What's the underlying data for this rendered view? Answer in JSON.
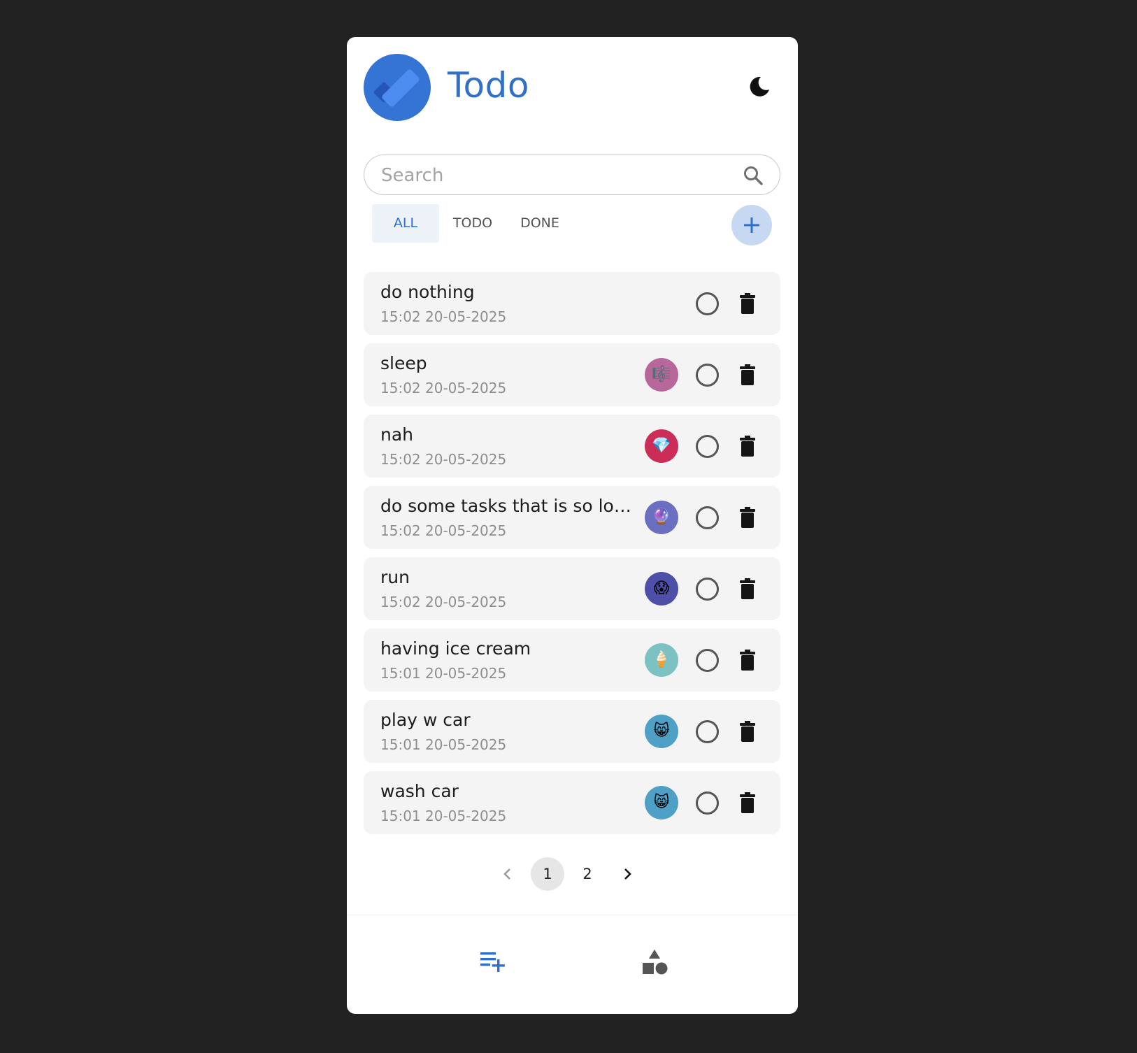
{
  "app": {
    "title": "Todo",
    "theme_toggle_icon": "moon-icon"
  },
  "search": {
    "placeholder": "Search",
    "value": "",
    "icon": "search-icon"
  },
  "filters": {
    "tabs": [
      {
        "label": "ALL",
        "active": true
      },
      {
        "label": "TODO",
        "active": false
      },
      {
        "label": "DONE",
        "active": false
      }
    ],
    "add_icon": "plus-icon"
  },
  "todos": [
    {
      "title": "do nothing",
      "time": "15:02 20-05-2025",
      "emoji": "",
      "emoji_bg": "",
      "done": false
    },
    {
      "title": "sleep",
      "time": "15:02 20-05-2025",
      "emoji": "🎼",
      "emoji_bg": "#b8679a",
      "done": false
    },
    {
      "title": "nah",
      "time": "15:02 20-05-2025",
      "emoji": "💎",
      "emoji_bg": "#cc2c58",
      "done": false
    },
    {
      "title": "do some tasks that is so long...",
      "time": "15:02 20-05-2025",
      "emoji": "🔮",
      "emoji_bg": "#6b6fbf",
      "done": false
    },
    {
      "title": "run",
      "time": "15:02 20-05-2025",
      "emoji": "😱",
      "emoji_bg": "#4e4fa8",
      "done": false
    },
    {
      "title": "having ice cream",
      "time": "15:01 20-05-2025",
      "emoji": "🍦",
      "emoji_bg": "#7cc2c2",
      "done": false
    },
    {
      "title": "play w car",
      "time": "15:01 20-05-2025",
      "emoji": "😸",
      "emoji_bg": "#4fa0c6",
      "done": false
    },
    {
      "title": "wash car",
      "time": "15:01 20-05-2025",
      "emoji": "😸",
      "emoji_bg": "#4fa0c6",
      "done": false
    }
  ],
  "pagination": {
    "prev_icon": "chevron-left-icon",
    "pages": [
      "1",
      "2"
    ],
    "current": "1",
    "next_icon": "chevron-right-icon"
  },
  "bottom_nav": [
    {
      "icon": "playlist-add-icon",
      "color": "#3170c9",
      "active": true
    },
    {
      "icon": "category-shapes-icon",
      "color": "#555555",
      "active": false
    }
  ],
  "colors": {
    "accent": "#3170c9",
    "page_background": "#222222",
    "card_background": "#ffffff",
    "item_background": "#f4f4f4"
  }
}
